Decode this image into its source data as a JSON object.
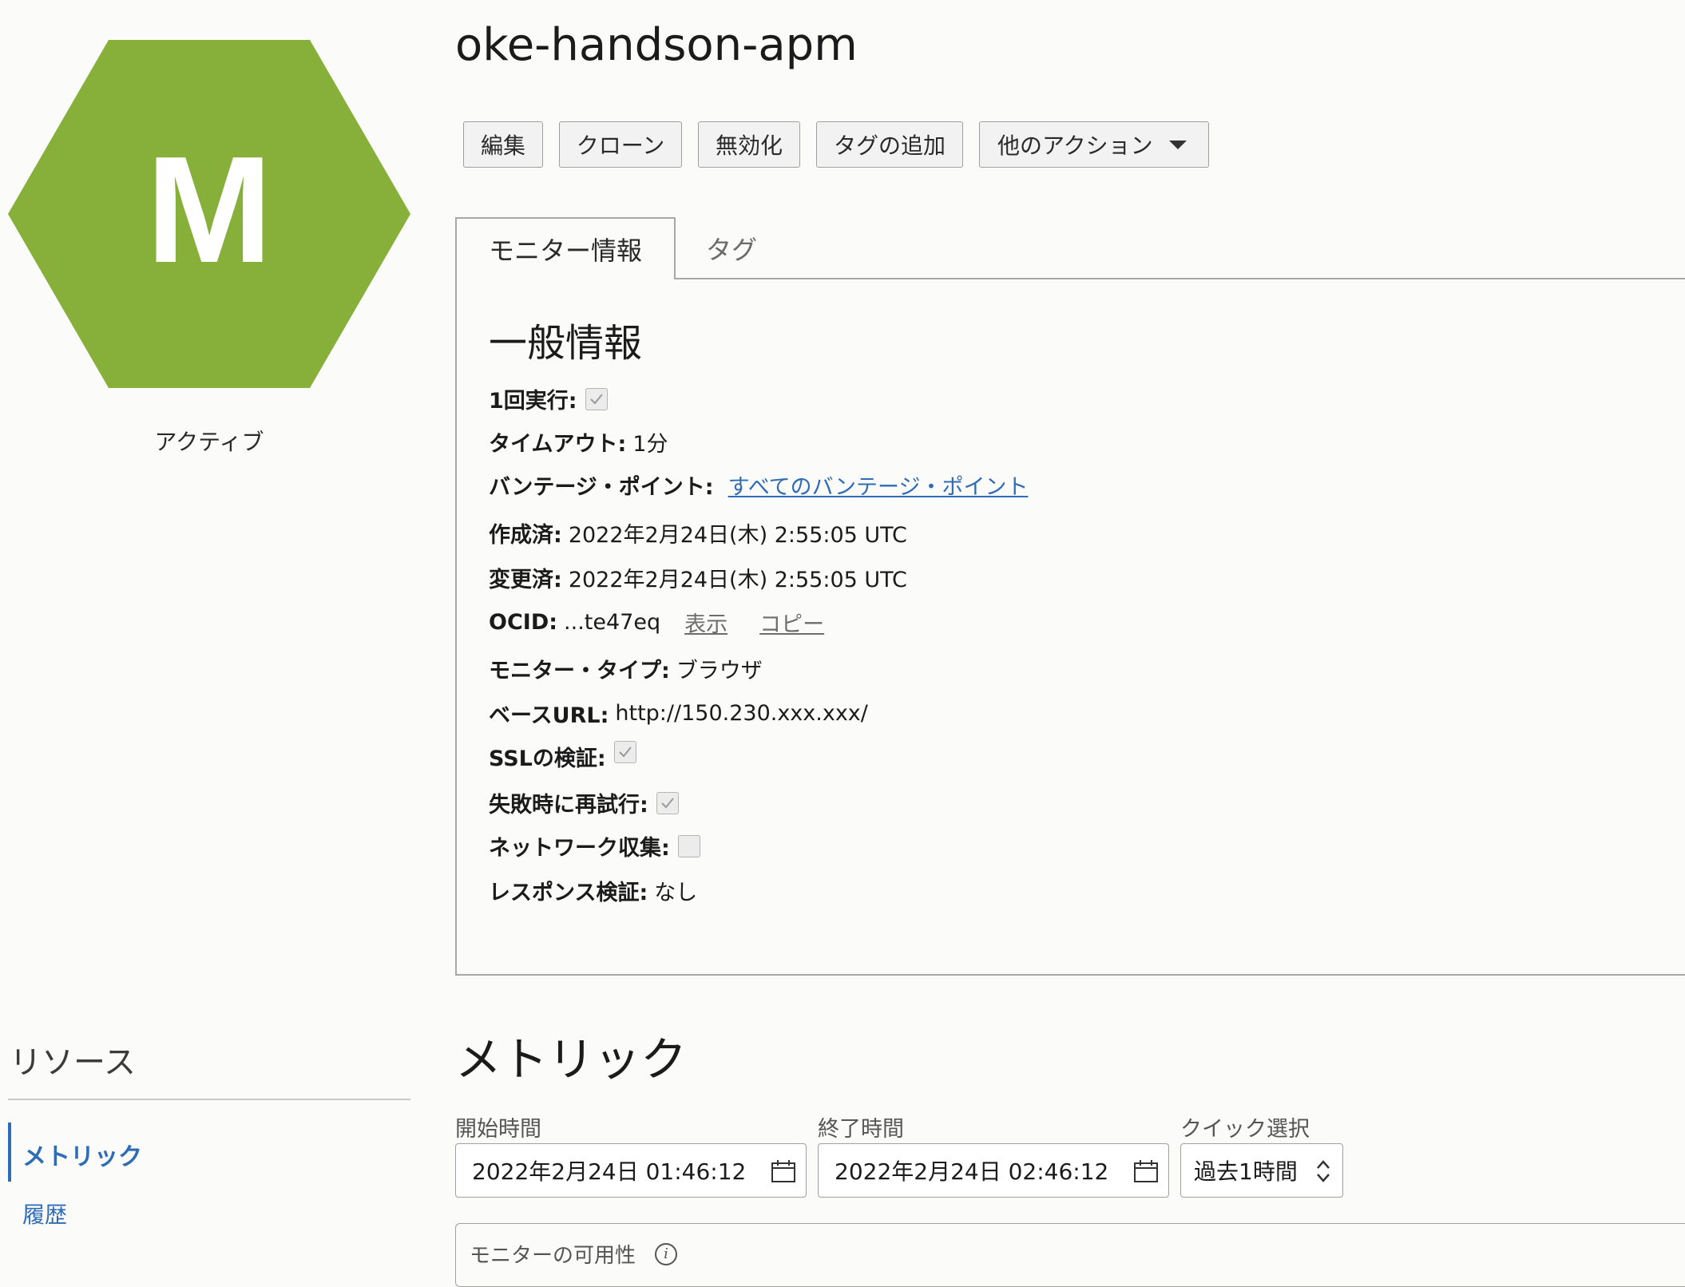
{
  "monitor": {
    "initial": "M",
    "status": "アクティブ",
    "title": "oke-handson-apm",
    "brand_color": "#86b03a"
  },
  "actions": {
    "edit": "編集",
    "clone": "クローン",
    "disable": "無効化",
    "add_tag": "タグの追加",
    "more": "他のアクション"
  },
  "tabs": {
    "monitor_info": "モニター情報",
    "tags": "タグ"
  },
  "general": {
    "title": "一般情報",
    "run_once_label": "1回実行:",
    "run_once": true,
    "timeout_label": "タイムアウト:",
    "timeout_value": "1分",
    "vantage_label": "バンテージ・ポイント:",
    "vantage_value": "すべてのバンテージ・ポイント",
    "created_label": "作成済:",
    "created_value": "2022年2月24日(木) 2:55:05 UTC",
    "updated_label": "変更済:",
    "updated_value": "2022年2月24日(木) 2:55:05 UTC",
    "ocid_label": "OCID:",
    "ocid_value": "...te47eq",
    "ocid_show": "表示",
    "ocid_copy": "コピー",
    "type_label": "モニター・タイプ:",
    "type_value": "ブラウザ",
    "base_url_label": "ベースURL:",
    "base_url_value": "http://150.230.xxx.xxx/",
    "ssl_label": "SSLの検証:",
    "ssl": true,
    "retry_label": "失敗時に再試行:",
    "retry": true,
    "network_label": "ネットワーク収集:",
    "network": false,
    "response_label": "レスポンス検証:",
    "response_value": "なし"
  },
  "resources": {
    "title": "リソース",
    "metrics": "メトリック",
    "history": "履歴"
  },
  "metrics": {
    "title": "メトリック",
    "start_label": "開始時間",
    "start_value": "2022年2月24日 01:46:12",
    "end_label": "終了時間",
    "end_value": "2022年2月24日 02:46:12",
    "quick_label": "クイック選択",
    "quick_value": "過去1時間",
    "availability_label": "モニターの可用性"
  }
}
